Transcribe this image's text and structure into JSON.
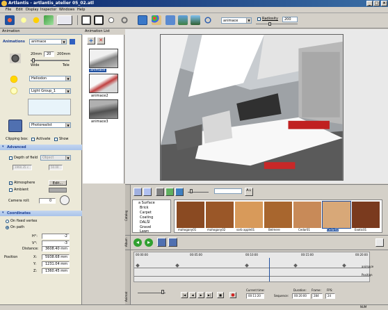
{
  "window": {
    "title": "Artlantis - artlantis_atelier 05_02.atl",
    "buttons": [
      "_",
      "□",
      "×"
    ]
  },
  "menu": [
    "File",
    "Edit",
    "Display",
    "Inspector",
    "Windows",
    "Help"
  ],
  "toolbar": {
    "tools": [
      "shaders-icon",
      "lights-icon",
      "heliodon-icon",
      "objects-icon",
      "render-icon",
      "perspective-icon",
      "export-icon",
      "zoom-icon",
      "settings-icon",
      "folder-icon",
      "palette-icon",
      "preview-icon",
      "photo-icon",
      "image-icon",
      "link-icon"
    ],
    "view_select": "animace",
    "radiosity_label": "Radiosity",
    "radiosity_value": "200"
  },
  "left": {
    "header": "Animation",
    "animations_label": "Animations",
    "animation_select": "animace",
    "lens": {
      "wide_value": "20mm",
      "focal": "20",
      "tele_value": "200mm",
      "wide": "Wide",
      "tele": "Tele"
    },
    "sun_select": "Heliodon",
    "light_select": "Light Group_1",
    "render_select": "Photorealist",
    "clipping_label": "Clipping box:",
    "activate": "Activate",
    "show": "Show",
    "advanced": "Advanced",
    "depth_of_field": "Depth of field",
    "dof_object": "Object",
    "dof_values": [
      "1960.35 c",
      "50.00"
    ],
    "atmosphere": "Atmosphere",
    "edit": "Edit...",
    "ambient": "Ambient",
    "camera_roll_label": "Camera roll:",
    "camera_roll": "0",
    "coordinates": "Coordinates",
    "on_fixed_vertex": "On fixed vertex",
    "on_path": "On path",
    "coords": [
      {
        "label": "H°:",
        "value": "-2"
      },
      {
        "label": "V°:",
        "value": "-3"
      },
      {
        "label": "Distance:",
        "value": "3608.40 mm"
      }
    ],
    "position_label": "Position",
    "position": [
      {
        "label": "X:",
        "value": "5938.68 mm"
      },
      {
        "label": "Y:",
        "value": "1231.04 mm"
      },
      {
        "label": "Z:",
        "value": "1360.45 mm"
      }
    ]
  },
  "anim_list": {
    "header": "Animation List",
    "items": [
      "animace",
      "animace2",
      "animace3"
    ]
  },
  "catalog": {
    "side_label": "Catalog",
    "tree": [
      "a Surface",
      "Brick",
      "Carpet",
      "Coating",
      "DALŠÍ",
      "Gravel",
      "Lawn"
    ],
    "swatches": [
      {
        "name": "mahogany01",
        "color": "#8a4a22"
      },
      {
        "name": "mahogany02",
        "color": "#9a5728"
      },
      {
        "name": "sorb apple01",
        "color": "#d89a5a"
      },
      {
        "name": "Belmere",
        "color": "#a8662e"
      },
      {
        "name": "Cedar01",
        "color": "#c88a58"
      },
      {
        "name": "Cedar02",
        "color": "#d8a878"
      },
      {
        "name": "Exotic01",
        "color": "#7a3a1e"
      }
    ],
    "selected": "Cedar02"
  },
  "album_label": "Album",
  "timeline": {
    "side_label": "Animat",
    "times": [
      "00:00:00",
      "00:05:00",
      "00:10:00",
      "00:15:00",
      "00:20:00"
    ],
    "tracks": [
      "animace",
      "Position"
    ],
    "current_time_label": "Current time:",
    "current_time": "00:11:20",
    "sequence_label": "Sequence:",
    "duration_label": "Duration:",
    "duration": "00:20:00",
    "frame_label": "Frame:",
    "frame": "284",
    "fps_label": "FPS:",
    "fps": "24"
  },
  "status": "NUM"
}
